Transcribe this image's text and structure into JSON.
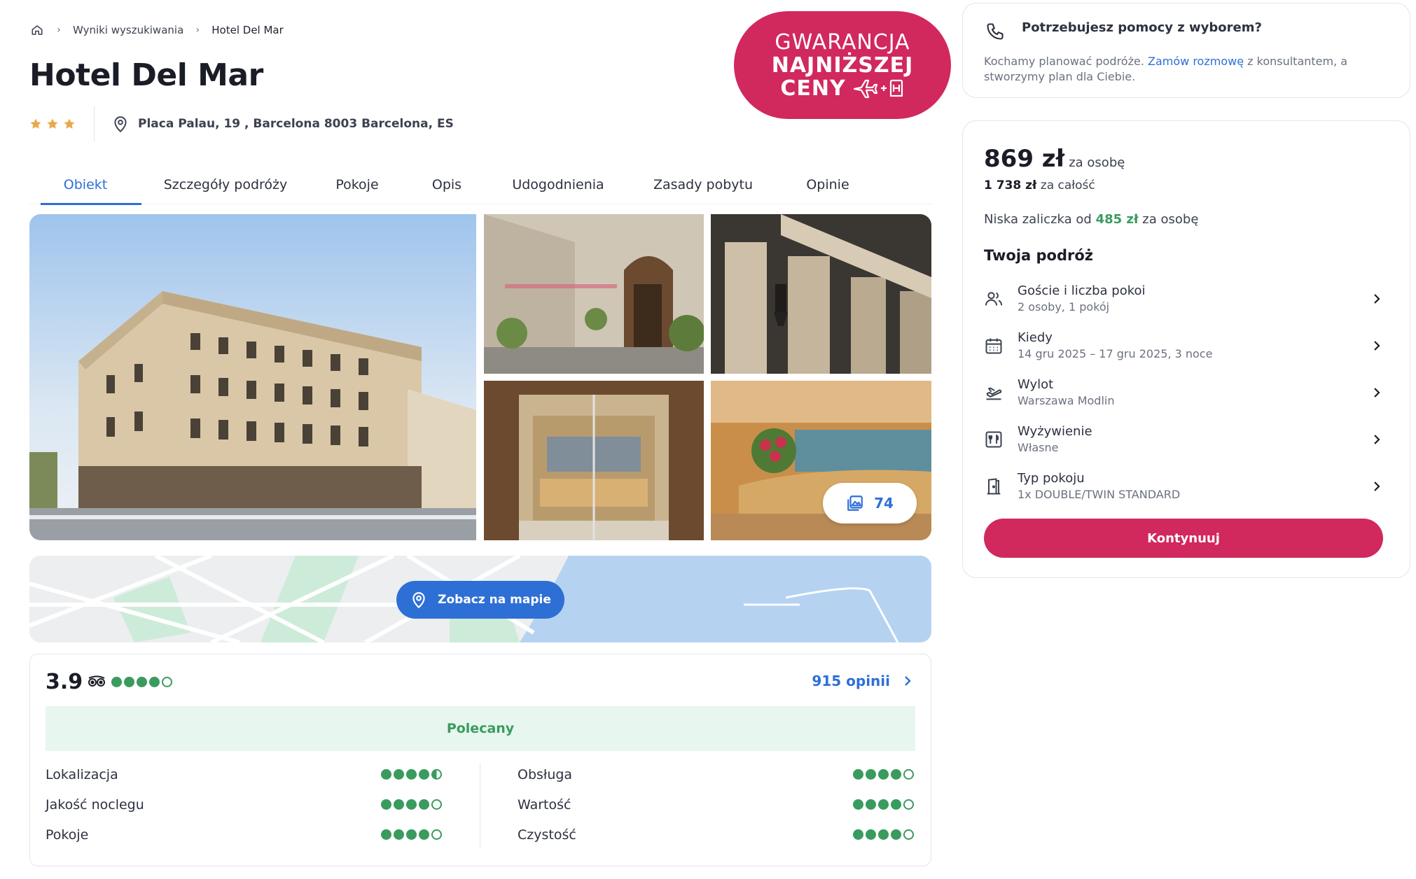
{
  "breadcrumb": {
    "home_icon": "home-icon",
    "items": [
      "Wyniki wyszukiwania",
      "Hotel Del Mar"
    ]
  },
  "hotel": {
    "name": "Hotel Del Mar",
    "stars": 3,
    "address": "Placa Palau, 19 , Barcelona 8003 Barcelona, ES"
  },
  "badge": {
    "line1": "GWARANCJA",
    "line2": "NAJNIŻSZEJ",
    "line3": "CENY",
    "color": "#d1285e"
  },
  "tabs": [
    {
      "label": "Obiekt",
      "active": true
    },
    {
      "label": "Szczegóły podróży",
      "active": false
    },
    {
      "label": "Pokoje",
      "active": false
    },
    {
      "label": "Opis",
      "active": false
    },
    {
      "label": "Udogodnienia",
      "active": false
    },
    {
      "label": "Zasady pobytu",
      "active": false
    },
    {
      "label": "Opinie",
      "active": false
    }
  ],
  "gallery": {
    "photo_count": "74"
  },
  "map": {
    "button_label": "Zobacz na mapie"
  },
  "reviews": {
    "score": "3.9",
    "score_rating": 4,
    "count_label": "915 opinii",
    "badge": "Polecany",
    "categories_left": [
      {
        "label": "Lokalizacja",
        "rating": 4.5
      },
      {
        "label": "Jakość noclegu",
        "rating": 4
      },
      {
        "label": "Pokoje",
        "rating": 4
      }
    ],
    "categories_right": [
      {
        "label": "Obsługa",
        "rating": 4
      },
      {
        "label": "Wartość",
        "rating": 4
      },
      {
        "label": "Czystość",
        "rating": 4
      }
    ]
  },
  "help": {
    "title": "Potrzebujesz pomocy z wyborem?",
    "text_before": "Kochamy planować podróże. ",
    "link": "Zamów rozmowę",
    "text_after": " z konsultantem, a stworzymy plan dla Ciebie."
  },
  "booking": {
    "price": "869 zł",
    "price_unit": "za osobę",
    "total_amount": "1 738 zł",
    "total_label": "za całość",
    "deposit_prefix": "Niska zaliczka od ",
    "deposit_amount": "485 zł",
    "deposit_suffix": " za osobę",
    "trip_title": "Twoja podróż",
    "options": [
      {
        "icon": "guests-icon",
        "label": "Goście i liczba pokoi",
        "value": "2 osoby, 1 pokój"
      },
      {
        "icon": "calendar-icon",
        "label": "Kiedy",
        "value": "14 gru 2025 – 17 gru 2025, 3 noce"
      },
      {
        "icon": "plane-departure-icon",
        "label": "Wylot",
        "value": "Warszawa Modlin"
      },
      {
        "icon": "meal-icon",
        "label": "Wyżywienie",
        "value": "Własne"
      },
      {
        "icon": "door-icon",
        "label": "Typ pokoju",
        "value": "1x DOUBLE/TWIN STANDARD"
      }
    ],
    "cta": "Kontynuuj"
  },
  "colors": {
    "accent_blue": "#2e6fd6",
    "brand_pink": "#d1285e",
    "green": "#3a9b5f"
  }
}
